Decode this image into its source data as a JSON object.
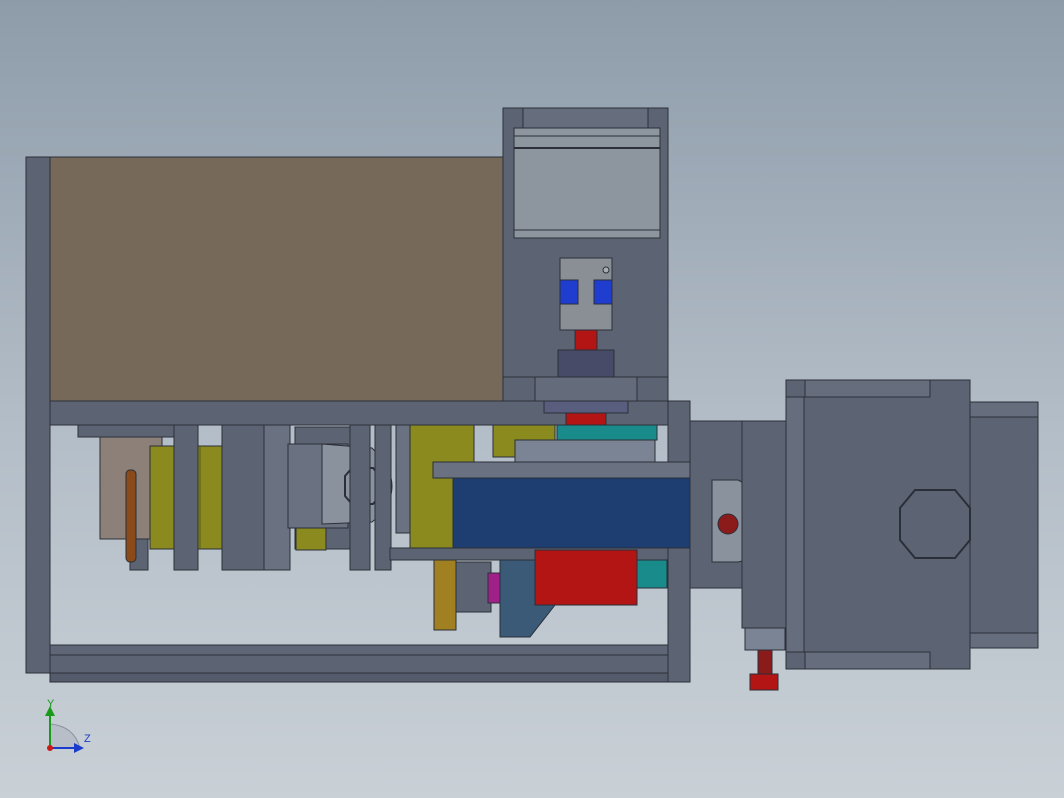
{
  "triad": {
    "y_label": "Y",
    "z_label": "Z",
    "colors": {
      "y_axis": "#1a9a1a",
      "z_axis": "#1a3ccc",
      "origin": "#cc1a1a"
    }
  },
  "colors": {
    "background_top": "#8e9caa",
    "background_bottom": "#c9d0d6",
    "frame": "#5c6474",
    "frame_edge": "#2b2f38",
    "enclosure_panel": "#76695a",
    "motor_silver": "#8d969e",
    "coupling_blue": "#1f3ecf",
    "red_part": "#b31414",
    "blue_roller": "#1e3e72",
    "yellow_part": "#8a8a1e",
    "brass_part": "#a08020",
    "teal_part": "#1a8b8b",
    "copper_rod": "#8b4a1a",
    "magenta_part": "#a0208a"
  }
}
